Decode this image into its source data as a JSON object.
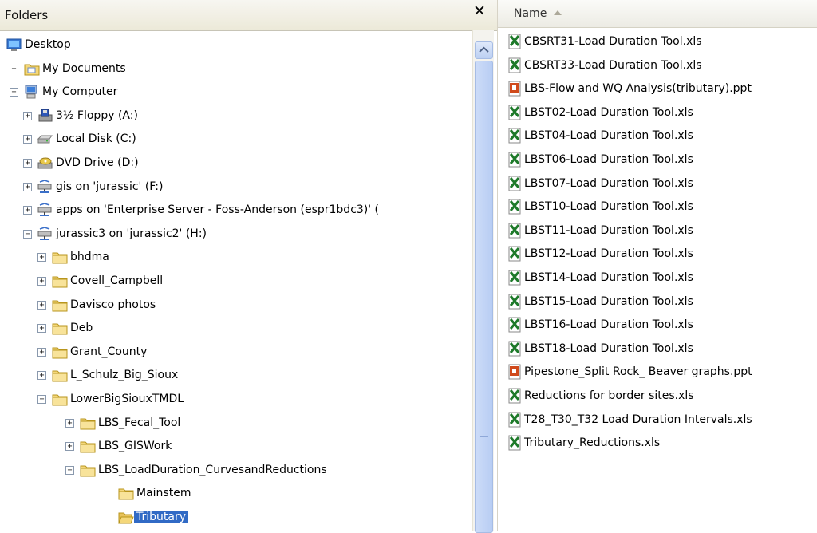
{
  "folders_pane": {
    "title": "Folders",
    "close_glyph": "✕",
    "tree": [
      {
        "id": "desktop",
        "label": "Desktop",
        "depth": 0,
        "expander": "",
        "icon": "desktop-icon"
      },
      {
        "id": "my-documents",
        "label": "My Documents",
        "depth": 1,
        "expander": "+",
        "icon": "folder-documents-icon"
      },
      {
        "id": "my-computer",
        "label": "My Computer",
        "depth": 1,
        "expander": "-",
        "icon": "computer-icon"
      },
      {
        "id": "floppy",
        "label": "3½ Floppy (A:)",
        "depth": 2,
        "expander": "+",
        "icon": "floppy-drive-icon"
      },
      {
        "id": "local-disk",
        "label": "Local Disk (C:)",
        "depth": 2,
        "expander": "+",
        "icon": "hard-drive-icon"
      },
      {
        "id": "dvd-drive",
        "label": "DVD Drive (D:)",
        "depth": 2,
        "expander": "+",
        "icon": "dvd-drive-icon"
      },
      {
        "id": "gis",
        "label": "gis on 'jurassic' (F:)",
        "depth": 2,
        "expander": "+",
        "icon": "network-drive-icon"
      },
      {
        "id": "apps",
        "label": "apps on 'Enterprise Server - Foss-Anderson (espr1bdc3)' (",
        "depth": 2,
        "expander": "+",
        "icon": "network-drive-icon"
      },
      {
        "id": "jurassic3",
        "label": "jurassic3 on 'jurassic2' (H:)",
        "depth": 2,
        "expander": "-",
        "icon": "network-drive-icon"
      },
      {
        "id": "bhdma",
        "label": "bhdma",
        "depth": 3,
        "expander": "+",
        "icon": "folder-icon"
      },
      {
        "id": "covell",
        "label": "Covell_Campbell",
        "depth": 3,
        "expander": "+",
        "icon": "folder-icon"
      },
      {
        "id": "davisco",
        "label": "Davisco photos",
        "depth": 3,
        "expander": "+",
        "icon": "folder-icon"
      },
      {
        "id": "deb",
        "label": "Deb",
        "depth": 3,
        "expander": "+",
        "icon": "folder-icon"
      },
      {
        "id": "grant",
        "label": "Grant_County",
        "depth": 3,
        "expander": "+",
        "icon": "folder-icon"
      },
      {
        "id": "lschulz",
        "label": "L_Schulz_Big_Sioux",
        "depth": 3,
        "expander": "+",
        "icon": "folder-icon"
      },
      {
        "id": "lowerbigsioux",
        "label": "LowerBigSiouxTMDL",
        "depth": 3,
        "expander": "-",
        "icon": "folder-icon"
      },
      {
        "id": "lbs-fecal",
        "label": "LBS_Fecal_Tool",
        "depth": 4,
        "expander": "+",
        "icon": "folder-icon"
      },
      {
        "id": "lbs-gis",
        "label": "LBS_GISWork",
        "depth": 4,
        "expander": "+",
        "icon": "folder-icon"
      },
      {
        "id": "lbs-load",
        "label": "LBS_LoadDuration_CurvesandReductions",
        "depth": 4,
        "expander": "-",
        "icon": "folder-icon"
      },
      {
        "id": "mainstem",
        "label": "Mainstem",
        "depth": 5,
        "expander": "",
        "icon": "folder-icon"
      },
      {
        "id": "tributary",
        "label": "Tributary",
        "depth": 5,
        "expander": "",
        "icon": "folder-open-icon",
        "selected": true
      }
    ]
  },
  "files_pane": {
    "name_column": "Name",
    "files": [
      {
        "name": "CBSRT31-Load Duration Tool.xls",
        "type": "excel"
      },
      {
        "name": "CBSRT33-Load Duration Tool.xls",
        "type": "excel"
      },
      {
        "name": "LBS-Flow and WQ Analysis(tributary).ppt",
        "type": "powerpoint"
      },
      {
        "name": "LBST02-Load Duration Tool.xls",
        "type": "excel"
      },
      {
        "name": "LBST04-Load Duration Tool.xls",
        "type": "excel"
      },
      {
        "name": "LBST06-Load Duration Tool.xls",
        "type": "excel"
      },
      {
        "name": "LBST07-Load Duration Tool.xls",
        "type": "excel"
      },
      {
        "name": "LBST10-Load Duration Tool.xls",
        "type": "excel"
      },
      {
        "name": "LBST11-Load Duration Tool.xls",
        "type": "excel"
      },
      {
        "name": "LBST12-Load Duration Tool.xls",
        "type": "excel"
      },
      {
        "name": "LBST14-Load Duration Tool.xls",
        "type": "excel"
      },
      {
        "name": "LBST15-Load Duration Tool.xls",
        "type": "excel"
      },
      {
        "name": "LBST16-Load Duration Tool.xls",
        "type": "excel"
      },
      {
        "name": "LBST18-Load Duration Tool.xls",
        "type": "excel"
      },
      {
        "name": "Pipestone_Split Rock_ Beaver graphs.ppt",
        "type": "powerpoint"
      },
      {
        "name": "Reductions for border sites.xls",
        "type": "excel"
      },
      {
        "name": "T28_T30_T32 Load Duration Intervals.xls",
        "type": "excel"
      },
      {
        "name": "Tributary_Reductions.xls",
        "type": "excel"
      }
    ]
  },
  "colors": {
    "selection": "#316ac5",
    "folder": "#f4d77a",
    "excel": "#1e7a2a",
    "powerpoint": "#d04a1c"
  }
}
